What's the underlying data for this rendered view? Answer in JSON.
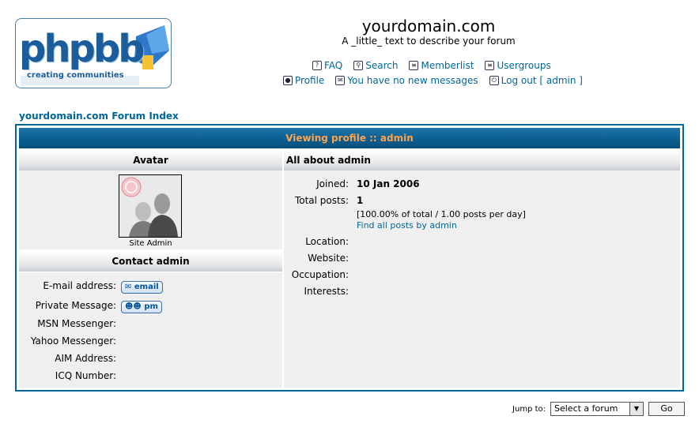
{
  "header": {
    "logo_main": "phpbb",
    "logo_tagline": "creating communities",
    "site_title": "yourdomain.com",
    "site_desc": "A _little_ text to describe your forum"
  },
  "nav": {
    "faq": "FAQ",
    "search": "Search",
    "memberlist": "Memberlist",
    "usergroups": "Usergroups",
    "profile": "Profile",
    "messages": "You have no new messages",
    "logout": "Log out [ admin ]"
  },
  "breadcrumb": "yourdomain.com Forum Index",
  "profile": {
    "header": "Viewing profile :: admin",
    "avatar_title": "Avatar",
    "rank": "Site Admin",
    "about_title": "All about admin",
    "contact_title": "Contact admin",
    "about": {
      "joined_label": "Joined:",
      "joined_value": "10 Jan 2006",
      "posts_label": "Total posts:",
      "posts_value": "1",
      "posts_stats": "[100.00% of total / 1.00 posts per day]",
      "find_posts": "Find all posts by admin",
      "location_label": "Location:",
      "website_label": "Website:",
      "occupation_label": "Occupation:",
      "interests_label": "Interests:"
    },
    "contact": {
      "email_label": "E-mail address:",
      "email_button": "email",
      "pm_label": "Private Message:",
      "pm_button": "pm",
      "msn_label": "MSN Messenger:",
      "yahoo_label": "Yahoo Messenger:",
      "aim_label": "AIM Address:",
      "icq_label": "ICQ Number:"
    }
  },
  "jump": {
    "label": "Jump to:",
    "selected": "Select a forum",
    "go": "Go"
  },
  "colors": {
    "accent": "#006699",
    "header_text": "#ffa34f",
    "row_bg": "#efefef"
  }
}
